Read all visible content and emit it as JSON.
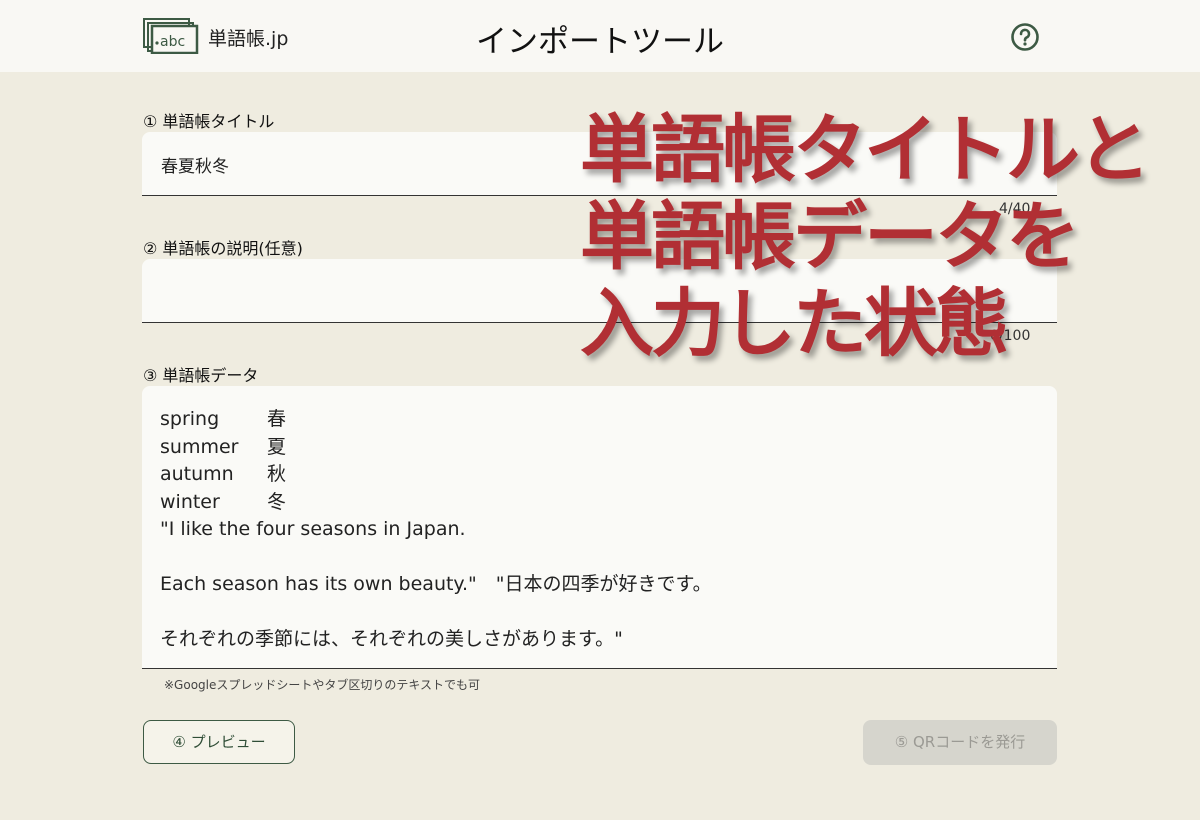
{
  "header": {
    "logo_text": "abc",
    "brand": "単語帳.jp",
    "title": "インポートツール",
    "help_icon": "question-circle-icon"
  },
  "title_field": {
    "label": "① 単語帳タイトル",
    "value": "春夏秋冬",
    "counter": "4/40"
  },
  "description_field": {
    "label": "② 単語帳の説明(任意)",
    "value": "",
    "counter": "0/100"
  },
  "data_field": {
    "label": "③ 単語帳データ",
    "pairs": [
      {
        "en": "spring",
        "ja": "春"
      },
      {
        "en": "summer",
        "ja": "夏"
      },
      {
        "en": "autumn",
        "ja": "秋"
      },
      {
        "en": "winter",
        "ja": "冬"
      }
    ],
    "lines": [
      "\"I like the four seasons in Japan.",
      "",
      "Each season has its own beauty.\"　\"日本の四季が好きです。",
      "",
      "それぞれの季節には、それぞれの美しさがあります。\""
    ],
    "hint": "※Googleスプレッドシートやタブ区切りのテキストでも可"
  },
  "buttons": {
    "preview": "④ プレビュー",
    "issue_qr": "⑤ QRコードを発行"
  },
  "overlay": {
    "line1": "単語帳タイトルと",
    "line2": "単語帳データを",
    "line3": "入力した状態"
  },
  "colors": {
    "background": "#efece0",
    "header_bg": "#f9f8f4",
    "accent_green": "#3d5a44",
    "overlay_red": "#b12f34",
    "disabled_button": "#d6d5cd"
  }
}
